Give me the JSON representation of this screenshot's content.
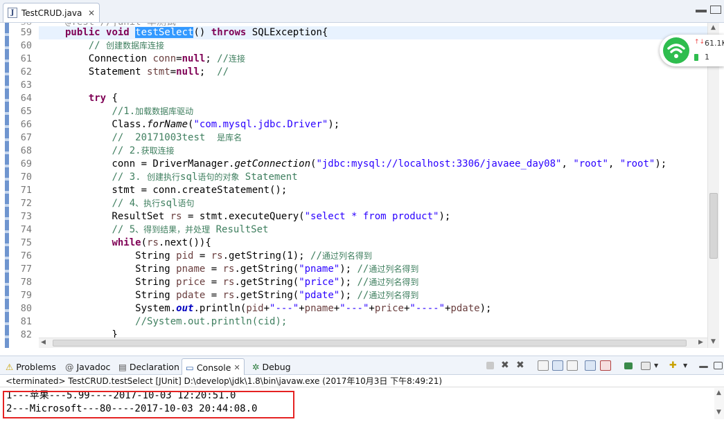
{
  "editor_tab": {
    "title": "TestCRUD.java",
    "close": "✕"
  },
  "partial_line": {
    "text": "@Test //junit 单测试"
  },
  "lines": [
    {
      "n": "59",
      "html": "<span class=\"kw\">public</span> <span class=\"kw\">void</span> <span class=\"sel\">testSelect</span>() <span class=\"kw\">throws</span> SQLException{"
    },
    {
      "n": "60",
      "html": "    <span class=\"cm\">// <span class=\"cn\">创建数据库连接</span></span>"
    },
    {
      "n": "61",
      "html": "    Connection <span class=\"var\">conn</span>=<span class=\"kw\">null</span>; <span class=\"cm\">//<span class=\"cn\">连接</span></span>"
    },
    {
      "n": "62",
      "html": "    Statement <span class=\"var\">stmt</span>=<span class=\"kw\">null</span>;  <span class=\"cm\">//</span>"
    },
    {
      "n": "63",
      "html": ""
    },
    {
      "n": "64",
      "html": "    <span class=\"kw\">try</span> {"
    },
    {
      "n": "65",
      "html": "        <span class=\"cm\">//1.<span class=\"cn\">加载数据库驱动</span></span>"
    },
    {
      "n": "66",
      "html": "        Class.<span class=\"it\">forName</span>(<span class=\"str\">\"com.mysql.jdbc.Driver\"</span>);"
    },
    {
      "n": "67",
      "html": "        <span class=\"cm\">//  20171003test  <span class=\"cn\">是库名</span></span>"
    },
    {
      "n": "68",
      "html": "        <span class=\"cm\">// 2.<span class=\"cn\">获取连接</span></span>"
    },
    {
      "n": "69",
      "html": "        conn = DriverManager.<span class=\"it\">getConnection</span>(<span class=\"str\">\"jdbc:mysql://localhost:3306/javaee_day08\"</span>, <span class=\"str\">\"root\"</span>, <span class=\"str\">\"root\"</span>);"
    },
    {
      "n": "70",
      "html": "        <span class=\"cm\">// 3. <span class=\"cn\">创建执行</span>sql<span class=\"cn\">语句的对象</span> Statement</span>"
    },
    {
      "n": "71",
      "html": "        stmt = conn.createStatement();"
    },
    {
      "n": "72",
      "html": "        <span class=\"cm\">// 4<span class=\"cn\">、执行</span>sql<span class=\"cn\">语句</span></span>"
    },
    {
      "n": "73",
      "html": "        ResultSet <span class=\"var\">rs</span> = stmt.executeQuery(<span class=\"str\">\"select * from product\"</span>);"
    },
    {
      "n": "74",
      "html": "        <span class=\"cm\">// 5<span class=\"cn\">、得到结果，并处理</span> ResultSet</span>"
    },
    {
      "n": "75",
      "html": "        <span class=\"kw\">while</span>(<span class=\"var\">rs</span>.next()){"
    },
    {
      "n": "76",
      "html": "            String <span class=\"var\">pid</span> = <span class=\"var\">rs</span>.getString(1); <span class=\"cm\">//<span class=\"cn\">通过列名得到</span></span>"
    },
    {
      "n": "77",
      "html": "            String <span class=\"var\">pname</span> = <span class=\"var\">rs</span>.getString(<span class=\"str\">\"pname\"</span>); <span class=\"cm\">//<span class=\"cn\">通过列名得到</span></span>"
    },
    {
      "n": "78",
      "html": "            String <span class=\"var\">price</span> = <span class=\"var\">rs</span>.getString(<span class=\"str\">\"price\"</span>); <span class=\"cm\">//<span class=\"cn\">通过列名得到</span></span>"
    },
    {
      "n": "79",
      "html": "            String <span class=\"var\">pdate</span> = <span class=\"var\">rs</span>.getString(<span class=\"str\">\"pdate\"</span>); <span class=\"cm\">//<span class=\"cn\">通过列名得到</span></span>"
    },
    {
      "n": "80",
      "html": "            System.<span class=\"fld\">out</span>.println(<span class=\"var\">pid</span>+<span class=\"str\">\"---\"</span>+<span class=\"var\">pname</span>+<span class=\"str\">\"---\"</span>+<span class=\"var\">price</span>+<span class=\"str\">\"----\"</span>+<span class=\"var\">pdate</span>);"
    },
    {
      "n": "81",
      "html": "            <span class=\"cm\">//System.out.println(cid);</span>"
    },
    {
      "n": "82",
      "html": "        }"
    }
  ],
  "widget": {
    "speed": "61.1K",
    "count": "1",
    "up": "↑↓"
  },
  "console_tabs": [
    {
      "label": "Problems",
      "icon": "problems-icon",
      "sym": "⚠"
    },
    {
      "label": "Javadoc",
      "icon": "javadoc-icon",
      "sym": "@"
    },
    {
      "label": "Declaration",
      "icon": "declaration-icon",
      "sym": "▤"
    },
    {
      "label": "Console",
      "icon": "console-icon",
      "sym": "▭",
      "close": "✕"
    },
    {
      "label": "Debug",
      "icon": "debug-icon",
      "sym": "✲"
    }
  ],
  "console": {
    "status": "<terminated> TestCRUD.testSelect [JUnit] D:\\develop\\jdk\\1.8\\bin\\javaw.exe (2017年10月3日 下午8:49:21)",
    "output": [
      "1---苹果---5.99----2017-10-03 12:20:51.0",
      "2---Microsoft---80----2017-10-03 20:44:08.0"
    ]
  },
  "colors": {
    "keyword": "#7f0055",
    "string": "#2a00ff",
    "comment": "#3f7f5f",
    "selection": "#3399ff",
    "highlight_box": "#e52222",
    "wifi": "#2ebd4e"
  }
}
